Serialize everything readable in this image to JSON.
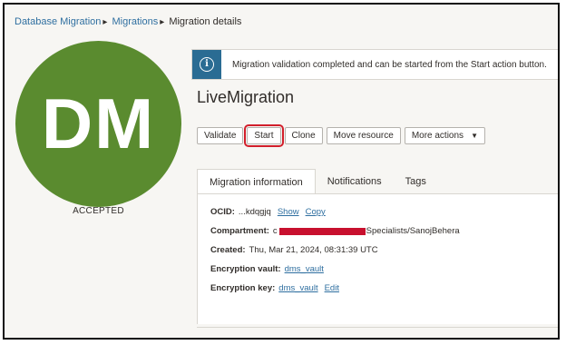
{
  "breadcrumb": {
    "items": [
      "Database Migration",
      "Migrations",
      "Migration details"
    ]
  },
  "avatar": {
    "initials": "DM",
    "color": "#5a8b2f",
    "status": "ACCEPTED"
  },
  "banner": {
    "icon": "info-icon",
    "message": "Migration validation completed and can be started from the Start action button."
  },
  "title": "LiveMigration",
  "toolbar": {
    "validate": "Validate",
    "start": "Start",
    "clone": "Clone",
    "move_resource": "Move resource",
    "more_actions": "More actions"
  },
  "tabs": [
    {
      "label": "Migration information",
      "active": true
    },
    {
      "label": "Notifications",
      "active": false
    },
    {
      "label": "Tags",
      "active": false
    }
  ],
  "info": {
    "ocid_label": "OCID:",
    "ocid_value": "...kdqgjq",
    "show_link": "Show",
    "copy_link": "Copy",
    "compartment_label": "Compartment:",
    "compartment_prefix": "c",
    "compartment_suffix": "Specialists/SanojBehera",
    "created_label": "Created:",
    "created_value": "Thu, Mar 21, 2024, 08:31:39 UTC",
    "vault_label": "Encryption vault:",
    "vault_value": "dms_vault",
    "key_label": "Encryption key:",
    "key_value": "dms_vault",
    "edit_link": "Edit"
  },
  "colors": {
    "accent": "#2a6c93",
    "link": "#2f6fa0",
    "highlight": "#d21f2b"
  }
}
